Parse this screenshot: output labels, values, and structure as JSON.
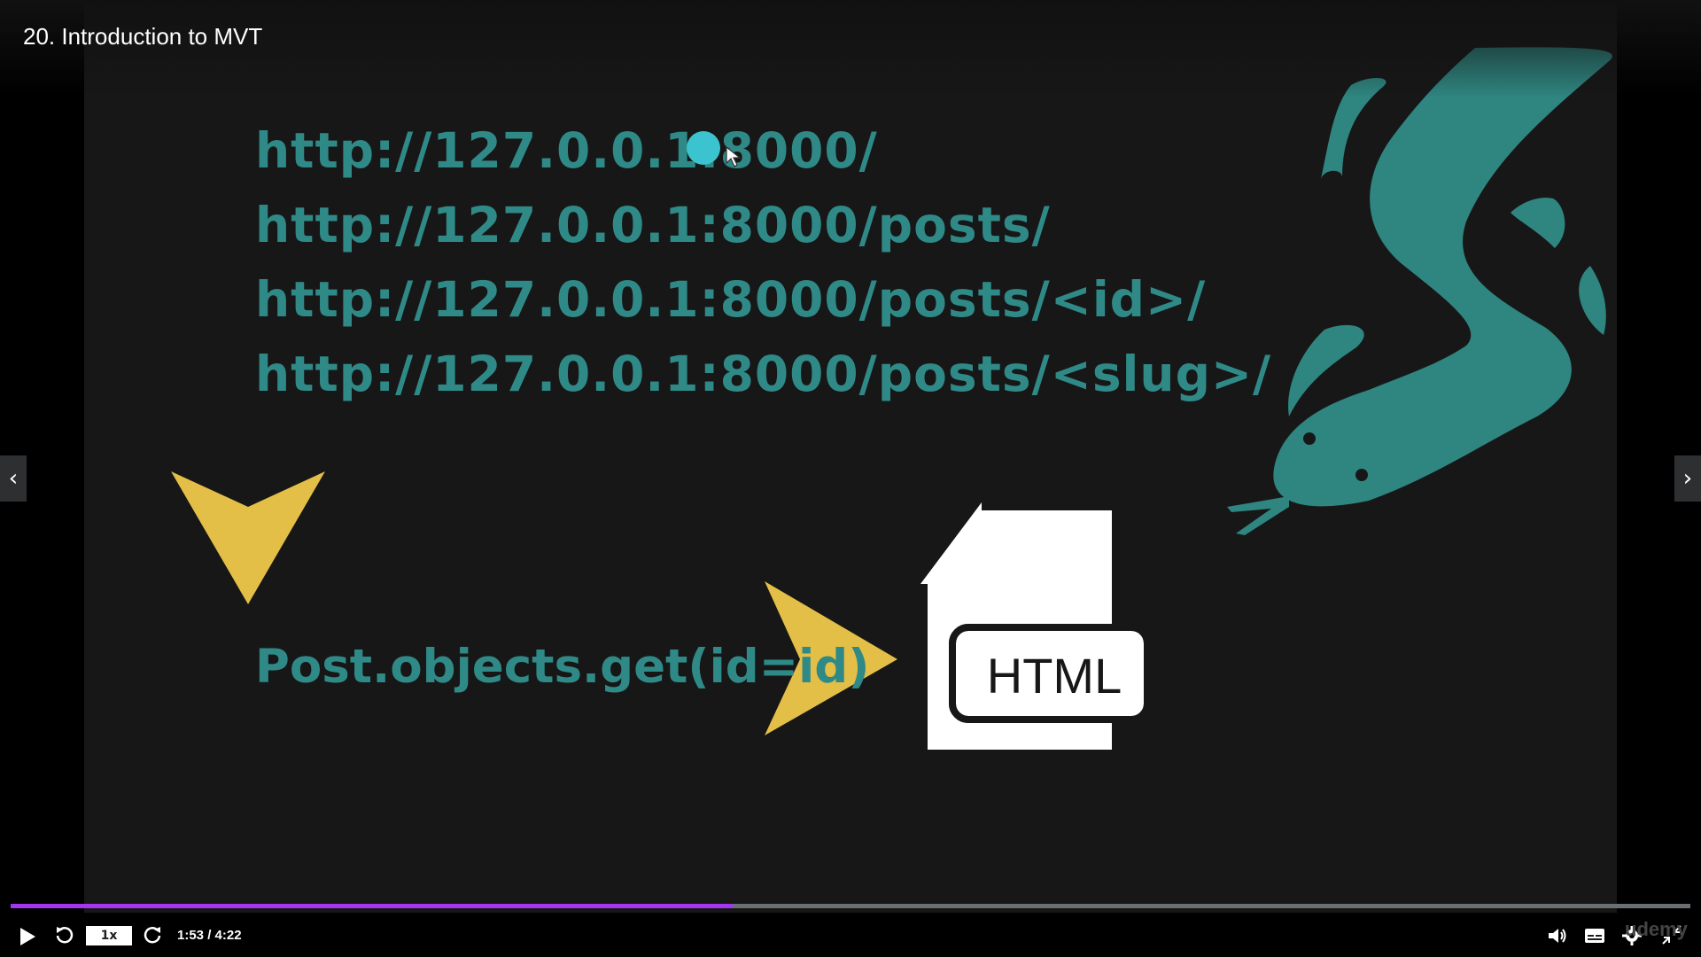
{
  "header": {
    "title": "20. Introduction to MVT"
  },
  "slide": {
    "urls": [
      "http://127.0.0.1:8000/",
      "http://127.0.0.1:8000/posts/",
      "http://127.0.0.1:8000/posts/<id>/",
      "http://127.0.0.1:8000/posts/<slug>/"
    ],
    "code": "Post.objects.get(id=id)",
    "file_label": "HTML",
    "colors": {
      "teal": "#2f8a87",
      "yellow": "#e3bf47",
      "dot": "#3cc3d0"
    }
  },
  "nav": {
    "prev_icon": "chevron-left-icon",
    "next_icon": "chevron-right-icon"
  },
  "player": {
    "progress_fraction": 0.43,
    "speed_label": "1x",
    "time": "1:53 / 4:22",
    "watermark": "udemy",
    "accent": "#a435f0"
  }
}
